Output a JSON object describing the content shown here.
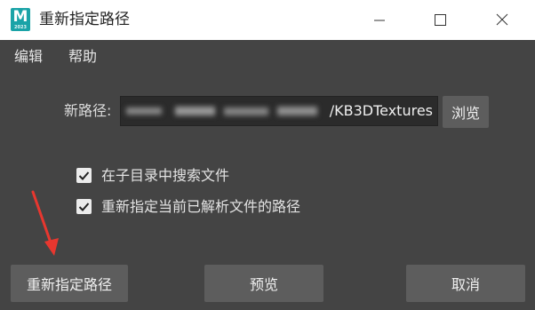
{
  "window": {
    "title": "重新指定路径",
    "app_icon": {
      "letter": "M",
      "sub_label": "2023",
      "color": "#1aa3a7"
    },
    "controls": [
      "minimize-icon",
      "maximize-icon",
      "close-icon"
    ]
  },
  "menu": {
    "items": [
      "编辑",
      "帮助"
    ]
  },
  "path": {
    "label": "新路径:",
    "value_visible_suffix": "/KB3DTextures",
    "browse_label": "浏览"
  },
  "options": [
    {
      "label": "在子目录中搜索文件",
      "checked": true
    },
    {
      "label": "重新指定当前已解析文件的路径",
      "checked": true
    }
  ],
  "buttons": {
    "relink": "重新指定路径",
    "preview": "预览",
    "cancel": "取消"
  },
  "colors": {
    "background": "#444444",
    "button": "#5d5d5d",
    "field": "#2b2b2b",
    "annotation_arrow": "#e8372f",
    "titlebar": "#ffffff"
  }
}
